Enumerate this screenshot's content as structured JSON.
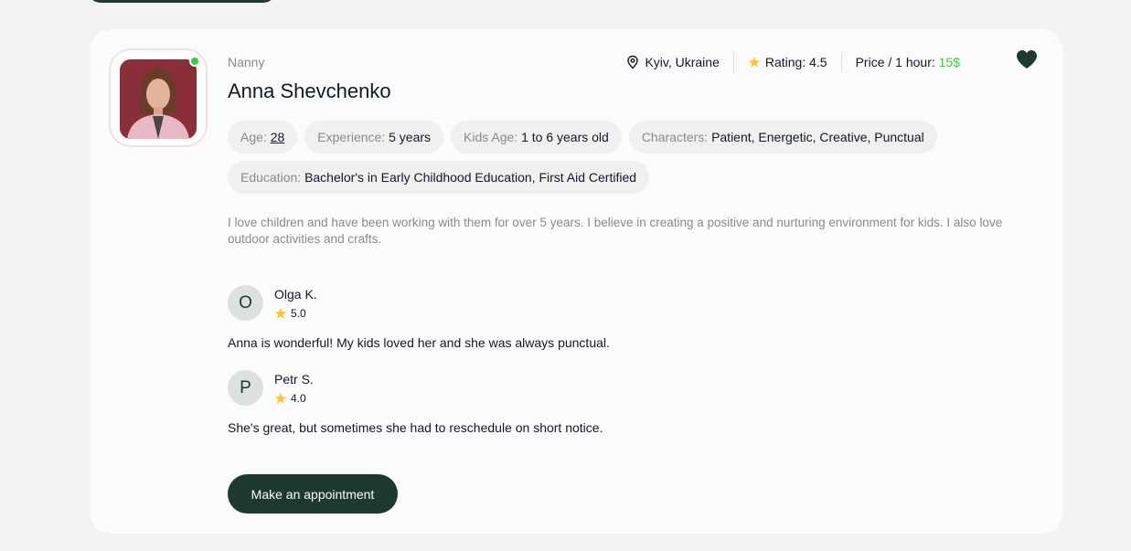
{
  "profile": {
    "role": "Nanny",
    "name": "Anna Shevchenko",
    "location": "Kyiv, Ukraine",
    "rating_label": "Rating: 4.5",
    "price_label": "Price / 1 hour: ",
    "price_value": "15$",
    "online": true,
    "favorite": true
  },
  "chips": {
    "age_label": "Age: ",
    "age_value": "28",
    "experience_label": "Experience: ",
    "experience_value": "5 years",
    "kids_age_label": "Kids Age: ",
    "kids_age_value": "1 to 6 years old",
    "characters_label": "Characters: ",
    "characters_value": "Patient, Energetic, Creative, Punctual",
    "education_label": "Education: ",
    "education_value": "Bachelor's in Early Childhood Education, First Aid Certified"
  },
  "about": "I love children and have been working with them for over 5 years. I believe in creating a positive and nurturing environment for kids. I also love outdoor activities and crafts.",
  "reviews": [
    {
      "initial": "O",
      "name": "Olga K.",
      "rating": "5.0",
      "text": "Anna is wonderful! My kids loved her and she was always punctual."
    },
    {
      "initial": "P",
      "name": "Petr S.",
      "rating": "4.0",
      "text": "She's great, but sometimes she had to reschedule on short notice."
    }
  ],
  "actions": {
    "appointment_label": "Make an appointment"
  },
  "colors": {
    "brand_dark": "#1e3a2f",
    "accent_green": "#38cd3e",
    "star": "#ffc531"
  },
  "icons": {
    "location": "map-pin-icon",
    "rating": "star-icon",
    "favorite": "heart-icon"
  }
}
